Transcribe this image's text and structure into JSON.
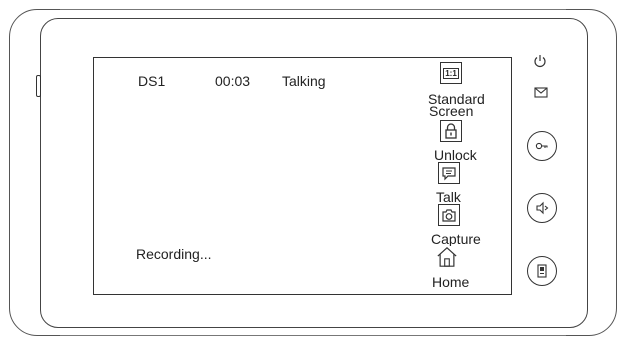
{
  "status": {
    "station": "DS1",
    "elapsed": "00:03",
    "state": "Talking",
    "recording": "Recording..."
  },
  "menu": {
    "standard_screen": {
      "icon_text": "1:1",
      "label_line1": "Standard",
      "label_line2": "Screen"
    },
    "unlock": {
      "label": "Unlock"
    },
    "talk": {
      "label": "Talk"
    },
    "capture": {
      "label": "Capture"
    },
    "home": {
      "label": "Home"
    }
  },
  "hardware": {
    "icons": [
      "power-icon",
      "message-icon"
    ],
    "buttons": [
      "unlock-key-button",
      "monitor-button",
      "menu-button"
    ]
  }
}
